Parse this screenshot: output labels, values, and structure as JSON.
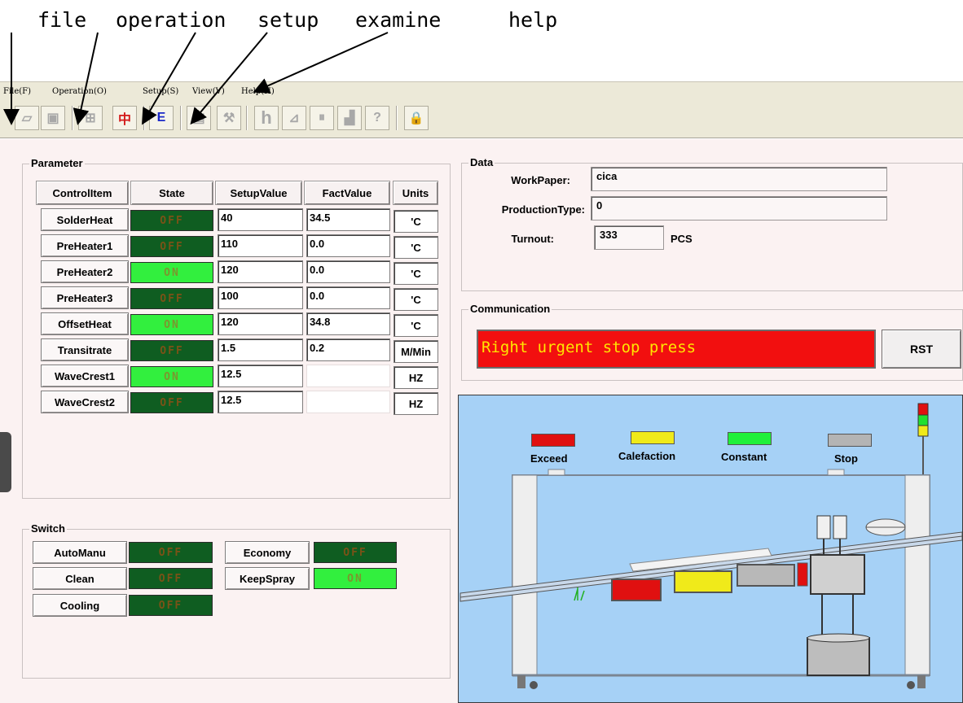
{
  "annotations": {
    "labels": [
      "file",
      "operation",
      "setup",
      "examine",
      "help"
    ]
  },
  "menu": [
    "File(F)",
    "Operation(O)",
    "Setup(S)",
    "View(V)",
    "Help(H)"
  ],
  "toolbar": {
    "buttons": [
      {
        "icon": "open-folder-icon",
        "glyph": "▱"
      },
      {
        "icon": "save-icon",
        "glyph": "▣"
      },
      {
        "icon": "settings-table-icon",
        "glyph": "⊞"
      },
      {
        "icon": "chinese-language-icon",
        "glyph": "中",
        "color": "#d31a1a"
      },
      {
        "icon": "english-language-icon",
        "glyph": "E",
        "color": "#1a28c8"
      },
      {
        "icon": "calendar-icon",
        "glyph": "▤"
      },
      {
        "icon": "tools-icon",
        "glyph": "⚒"
      },
      {
        "icon": "history-icon",
        "glyph": "h"
      },
      {
        "icon": "chart-icon",
        "glyph": "⊿"
      },
      {
        "icon": "pause-icon",
        "glyph": "⏸"
      },
      {
        "icon": "exit-icon",
        "glyph": "▟"
      },
      {
        "icon": "help-icon",
        "glyph": "?"
      },
      {
        "icon": "lock-icon",
        "glyph": "🔒"
      }
    ]
  },
  "parameter": {
    "title": "Parameter",
    "headers": [
      "ControlItem",
      "State",
      "SetupValue",
      "FactValue",
      "Units"
    ],
    "rows": [
      {
        "name": "SolderHeat",
        "state": "OFF",
        "setup": "40",
        "fact": "34.5",
        "unit": "'C"
      },
      {
        "name": "PreHeater1",
        "state": "OFF",
        "setup": "110",
        "fact": "0.0",
        "unit": "'C"
      },
      {
        "name": "PreHeater2",
        "state": "ON",
        "setup": "120",
        "fact": "0.0",
        "unit": "'C"
      },
      {
        "name": "PreHeater3",
        "state": "OFF",
        "setup": "100",
        "fact": "0.0",
        "unit": "'C"
      },
      {
        "name": "OffsetHeat",
        "state": "ON",
        "setup": "120",
        "fact": "34.8",
        "unit": "'C"
      },
      {
        "name": "Transitrate",
        "state": "OFF",
        "setup": "1.5",
        "fact": "0.2",
        "unit": "M/Min"
      },
      {
        "name": "WaveCrest1",
        "state": "ON",
        "setup": "12.5",
        "fact": "",
        "unit": "HZ"
      },
      {
        "name": "WaveCrest2",
        "state": "OFF",
        "setup": "12.5",
        "fact": "",
        "unit": "HZ"
      }
    ]
  },
  "switch": {
    "title": "Switch",
    "items": [
      {
        "name": "AutoManu",
        "state": "OFF"
      },
      {
        "name": "Economy",
        "state": "OFF"
      },
      {
        "name": "Clean",
        "state": "OFF"
      },
      {
        "name": "KeepSpray",
        "state": "ON"
      },
      {
        "name": "Cooling",
        "state": "OFF"
      }
    ]
  },
  "data": {
    "title": "Data",
    "work_paper_label": "WorkPaper:",
    "work_paper_value": "cica",
    "production_type_label": "ProductionType:",
    "production_type_value": "0",
    "turnout_label": "Turnout:",
    "turnout_value": "333",
    "turnout_unit": "PCS"
  },
  "communication": {
    "title": "Communication",
    "message": "Right urgent stop press",
    "reset_label": "RST"
  },
  "legend": [
    {
      "label": "Exceed",
      "color": "#e01010"
    },
    {
      "label": "Calefaction",
      "color": "#f0ea1a"
    },
    {
      "label": "Constant",
      "color": "#20f03a"
    },
    {
      "label": "Stop",
      "color": "#b4b4b4"
    }
  ]
}
